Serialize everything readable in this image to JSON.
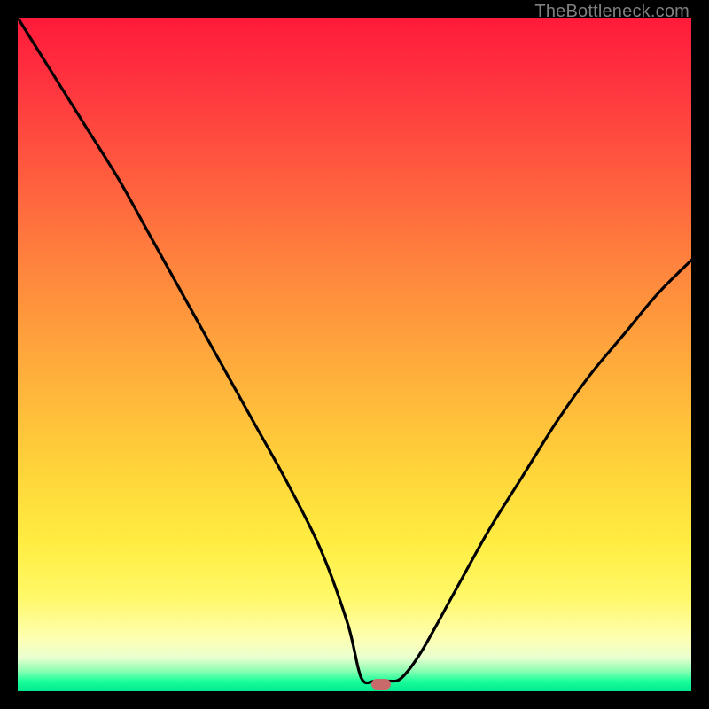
{
  "watermark": "TheBottleneck.com",
  "chart_data": {
    "type": "line",
    "title": "",
    "xlabel": "",
    "ylabel": "",
    "xlim": [
      0,
      100
    ],
    "ylim": [
      0,
      100
    ],
    "grid": false,
    "legend": false,
    "marker": {
      "x": 54,
      "y": 1,
      "color": "#c96a6a"
    },
    "series": [
      {
        "name": "curve",
        "color": "#000000",
        "x": [
          0,
          5,
          10,
          15,
          20,
          25,
          30,
          35,
          40,
          45,
          49,
          51,
          53,
          55,
          57,
          60,
          65,
          70,
          75,
          80,
          85,
          90,
          95,
          100
        ],
        "y": [
          100,
          92,
          84,
          76,
          67,
          58,
          49,
          40,
          31,
          21,
          10,
          2,
          1.5,
          1.5,
          2,
          6,
          15,
          24,
          32,
          40,
          47,
          53,
          59,
          64
        ]
      }
    ],
    "background_gradient_stops": [
      {
        "pos": 0.0,
        "color": "#ff1a3a"
      },
      {
        "pos": 0.18,
        "color": "#ff4c3f"
      },
      {
        "pos": 0.38,
        "color": "#ff873d"
      },
      {
        "pos": 0.58,
        "color": "#ffbc3b"
      },
      {
        "pos": 0.78,
        "color": "#ffed42"
      },
      {
        "pos": 0.92,
        "color": "#feffb0"
      },
      {
        "pos": 0.97,
        "color": "#8affb3"
      },
      {
        "pos": 1.0,
        "color": "#00e890"
      }
    ]
  }
}
